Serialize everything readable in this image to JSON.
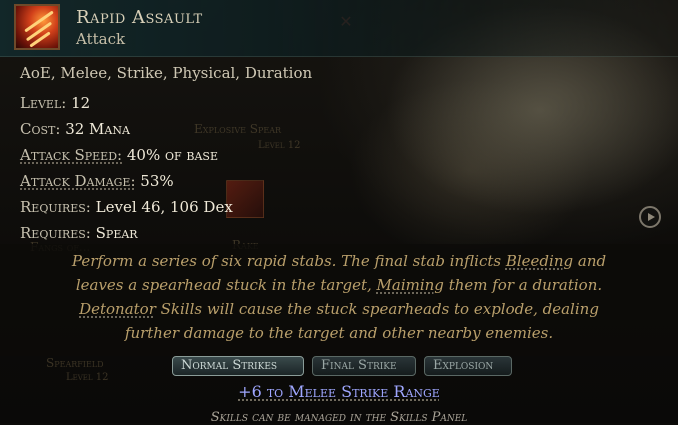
{
  "skill": {
    "name": "Rapid Assault",
    "type": "Attack",
    "icon": "rapid-assault-skill-icon",
    "tags": "AoE, Melee, Strike, Physical, Duration"
  },
  "stats": {
    "level_label": "Level:",
    "level_value": "12",
    "cost_label": "Cost:",
    "cost_value": "32 Mana",
    "attack_speed_label": "Attack Speed:",
    "attack_speed_value": "40% of base",
    "attack_damage_label": "Attack Damage:",
    "attack_damage_value": "53%",
    "requires1_label": "Requires:",
    "requires1_value": "Level 46, 106 Dex",
    "requires2_label": "Requires:",
    "requires2_value": "Spear"
  },
  "description": {
    "line1_pre": "Perform a series of six rapid stabs. The final stab inflicts ",
    "line1_link": "Bleeding",
    "line1_post": " and",
    "line2_pre": "leaves a spearhead stuck in the target, ",
    "line2_link": "Maiming",
    "line2_post": " them for a duration.",
    "line3_link": "Detonator",
    "line3_post": " Skills will cause the stuck spearheads to explode, dealing",
    "line4": "further damage to the target and other nearby enemies."
  },
  "tabs": [
    {
      "label": "Normal Strikes",
      "active": true
    },
    {
      "label": "Final Strike",
      "active": false
    },
    {
      "label": "Explosion",
      "active": false
    }
  ],
  "modifier": "+6 to Melee Strike Range",
  "footer": "Skills can be managed in the Skills Panel",
  "background_skills": {
    "explosive_spear": "Explosive Spear",
    "explosive_spear_level": "Level 12",
    "rake": "Rake",
    "fangs": "Fangs of...",
    "spearfield": "Spearfield",
    "spearfield_level": "Level 12"
  },
  "colors": {
    "label": "#c6c0ae",
    "value": "#efe9d8",
    "description": "#b99f6b",
    "modifier": "#9fa7ff",
    "header_bg": "#12282a"
  }
}
